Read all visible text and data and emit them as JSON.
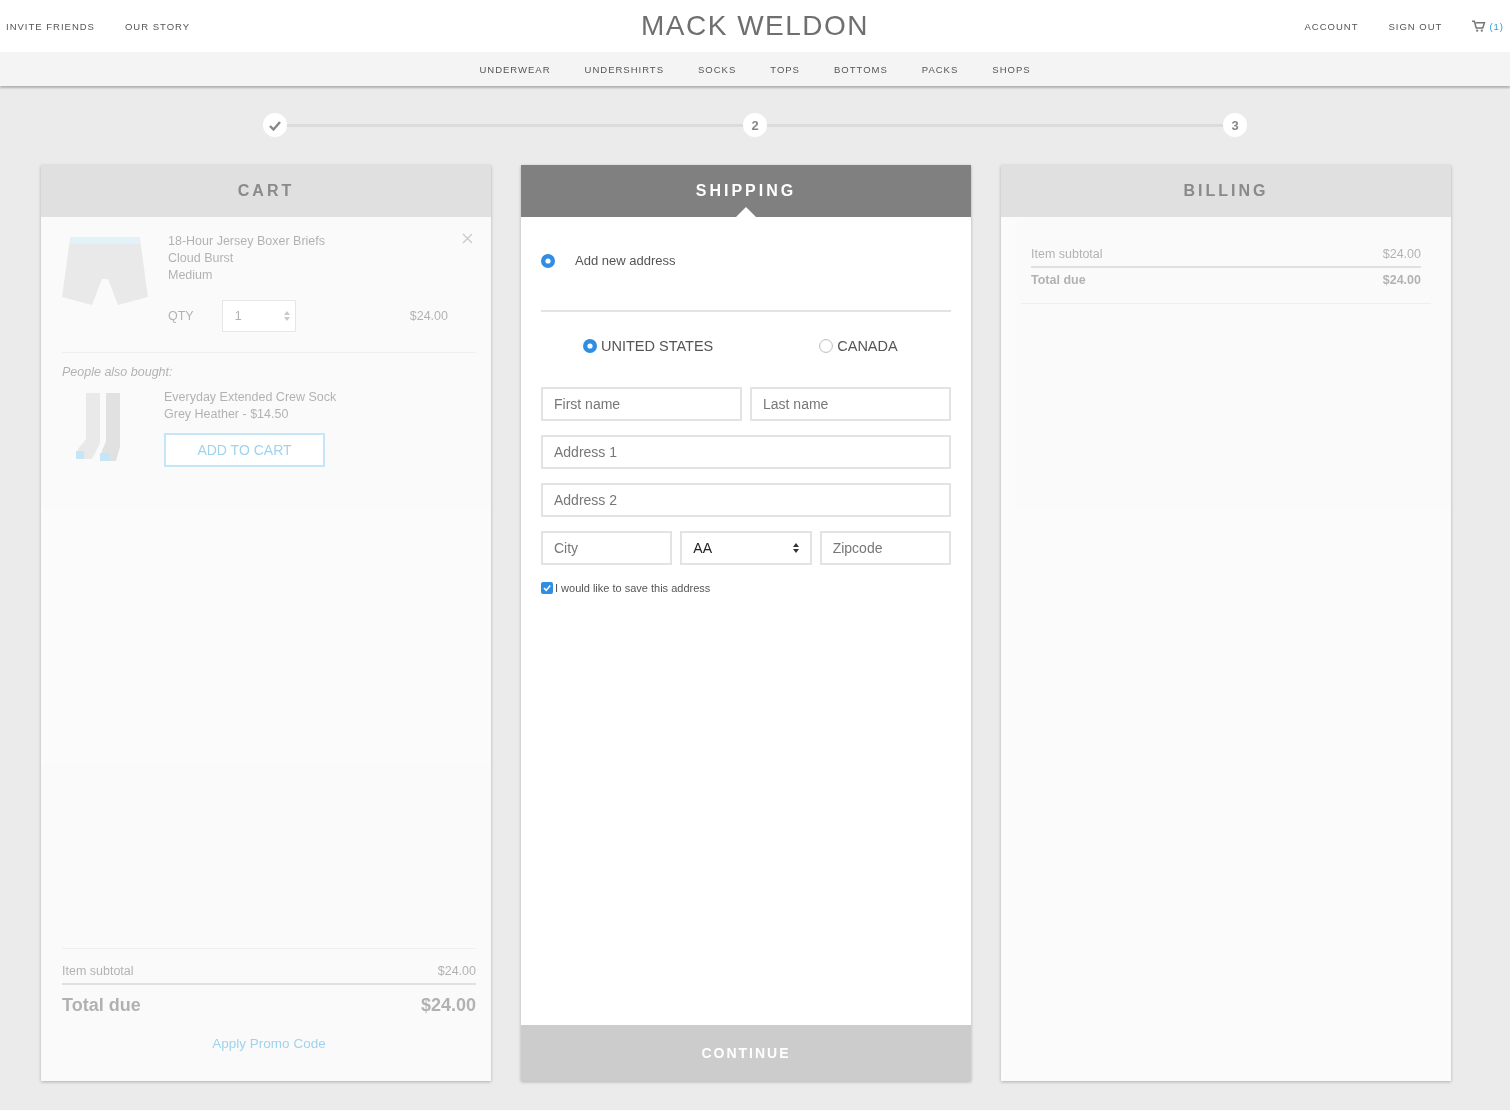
{
  "header": {
    "left_links": [
      "INVITE FRIENDS",
      "OUR STORY"
    ],
    "logo": "MACK WELDON",
    "right_links": [
      "ACCOUNT",
      "SIGN OUT"
    ],
    "cart_count": "(1)"
  },
  "nav": {
    "items": [
      "UNDERWEAR",
      "UNDERSHIRTS",
      "SOCKS",
      "TOPS",
      "BOTTOMS",
      "PACKS",
      "SHOPS"
    ]
  },
  "steps": [
    {
      "done": true
    },
    {
      "done": false,
      "label": "2"
    },
    {
      "done": false,
      "label": "3"
    }
  ],
  "cart": {
    "title": "CART",
    "active": false,
    "items": [
      {
        "name": "18-Hour Jersey Boxer Briefs",
        "variant": "Cloud Burst",
        "size": "Medium",
        "qty_label": "QTY",
        "qty": "1",
        "price": "$24.00"
      }
    ],
    "also_bought_label": "People also bought:",
    "recommendations": [
      {
        "name": "Everyday Extended Crew Sock",
        "detail": "Grey Heather - $14.50",
        "button": "ADD TO CART"
      }
    ],
    "subtotal_label": "Item subtotal",
    "subtotal": "$24.00",
    "total_label": "Total due",
    "total": "$24.00",
    "promo_link": "Apply Promo Code"
  },
  "shipping": {
    "title": "SHIPPING",
    "active": true,
    "address_options": [
      {
        "label": "Add new address",
        "selected": true
      }
    ],
    "countries": [
      {
        "label": "UNITED STATES",
        "selected": true
      },
      {
        "label": "CANADA",
        "selected": false
      }
    ],
    "first_name": {
      "placeholder": "First name"
    },
    "last_name": {
      "placeholder": "Last name"
    },
    "address1": {
      "placeholder": "Address 1"
    },
    "address2": {
      "placeholder": "Address 2"
    },
    "city": {
      "placeholder": "City"
    },
    "state": {
      "value": "AA"
    },
    "zipcode": {
      "placeholder": "Zipcode"
    },
    "save_address": {
      "label": "I would like to save this address",
      "checked": true
    },
    "continue_button": "CONTINUE"
  },
  "billing": {
    "title": "BILLING",
    "active": false,
    "subtotal_label": "Item subtotal",
    "subtotal": "$24.00",
    "total_label": "Total due",
    "total": "$24.00"
  }
}
